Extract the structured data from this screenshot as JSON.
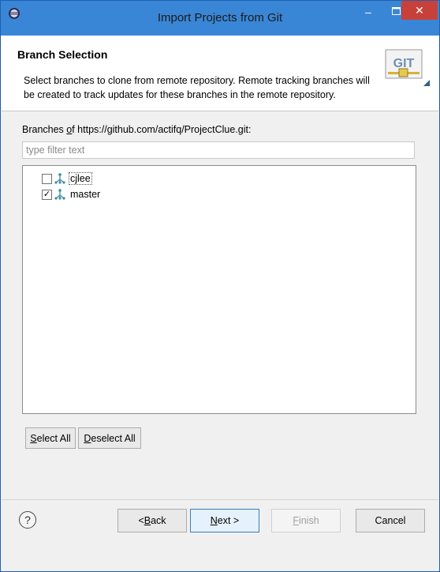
{
  "window": {
    "title": "Import Projects from Git"
  },
  "header": {
    "title": "Branch Selection",
    "description": "Select branches to clone from remote repository. Remote tracking branches will be created to track updates for these branches in the remote repository.",
    "logo_text": "GIT"
  },
  "branches": {
    "label_prefix": "Branches ",
    "label_mnemonic": "o",
    "label_rest": "f https://github.com/actifq/ProjectClue.git:",
    "filter_placeholder": "type filter text",
    "items": [
      {
        "label": "cjlee",
        "checked": false
      },
      {
        "label": "master",
        "checked": true
      }
    ]
  },
  "selection_buttons": {
    "select_all_mnemonic": "S",
    "select_all_rest": "elect All",
    "deselect_all_mnemonic": "D",
    "deselect_all_rest": "eselect All"
  },
  "footer": {
    "back_prefix": "< ",
    "back_mnemonic": "B",
    "back_rest": "ack",
    "next_mnemonic": "N",
    "next_rest": "ext >",
    "finish_mnemonic": "F",
    "finish_rest": "inish",
    "cancel": "Cancel",
    "help_glyph": "?"
  },
  "icons": {
    "app": "eclipse-icon",
    "help": "help-icon",
    "branch": "branch-icon",
    "logo": "git-logo"
  },
  "colors": {
    "titlebar": "#3a86d6",
    "close": "#c7413a",
    "branch_icon": "#3b8ea5"
  }
}
